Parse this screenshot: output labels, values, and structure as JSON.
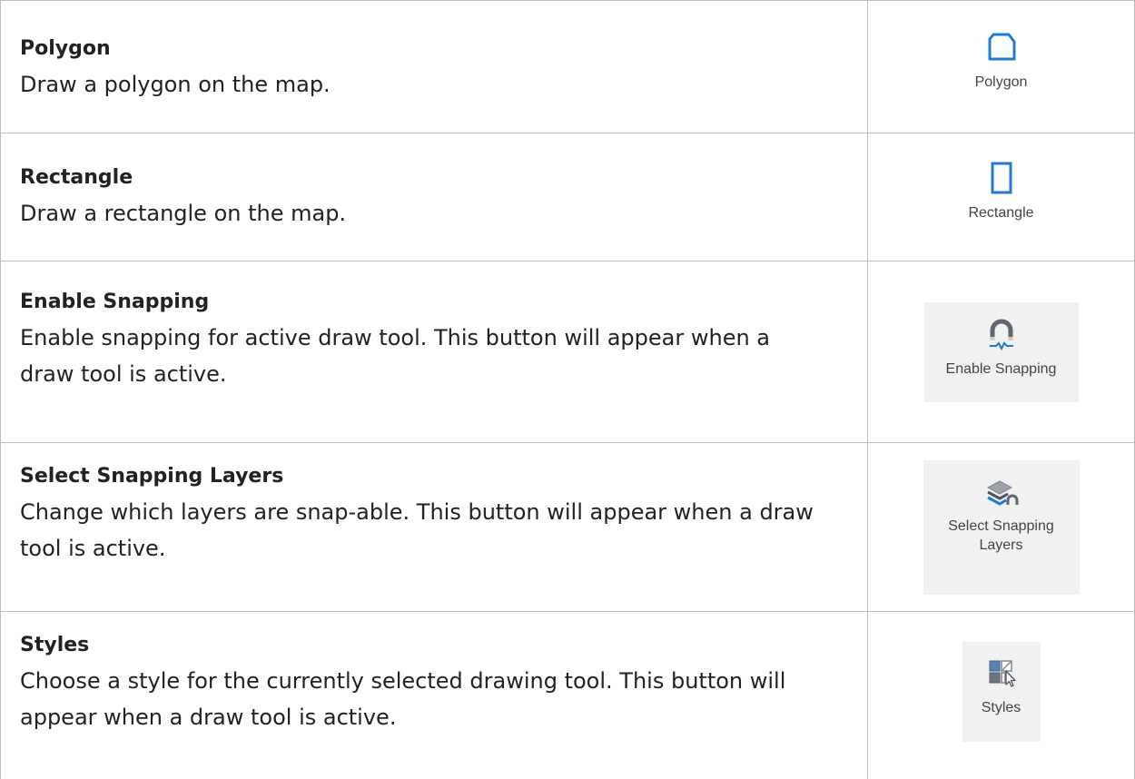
{
  "rows": [
    {
      "title": "Polygon",
      "description": "Draw a polygon on the map.",
      "button": {
        "label": "Polygon",
        "icon": "polygon-icon"
      }
    },
    {
      "title": "Rectangle",
      "description": "Draw a rectangle on the map.",
      "button": {
        "label": "Rectangle",
        "icon": "rectangle-icon"
      }
    },
    {
      "title": "Enable Snapping",
      "description": "Enable snapping for active draw tool. This button will appear when a draw tool is active.",
      "button": {
        "label": "Enable Snapping",
        "icon": "magnet-icon"
      }
    },
    {
      "title": "Select Snapping Layers",
      "description": "Change which layers are snap-able. This button will appear when a draw tool is active.",
      "button": {
        "label_line1": "Select Snapping",
        "label_line2": "Layers",
        "icon": "snapping-layers-icon"
      }
    },
    {
      "title": "Styles",
      "description": "Choose a style for the currently selected drawing tool. This button will appear when a draw tool is active.",
      "button": {
        "label": "Styles",
        "icon": "styles-icon"
      }
    }
  ],
  "colors": {
    "border": "#bdbdbd",
    "icon_blue": "#1f7ad1",
    "button_bg": "#f1f1f1",
    "text": "#222222"
  }
}
